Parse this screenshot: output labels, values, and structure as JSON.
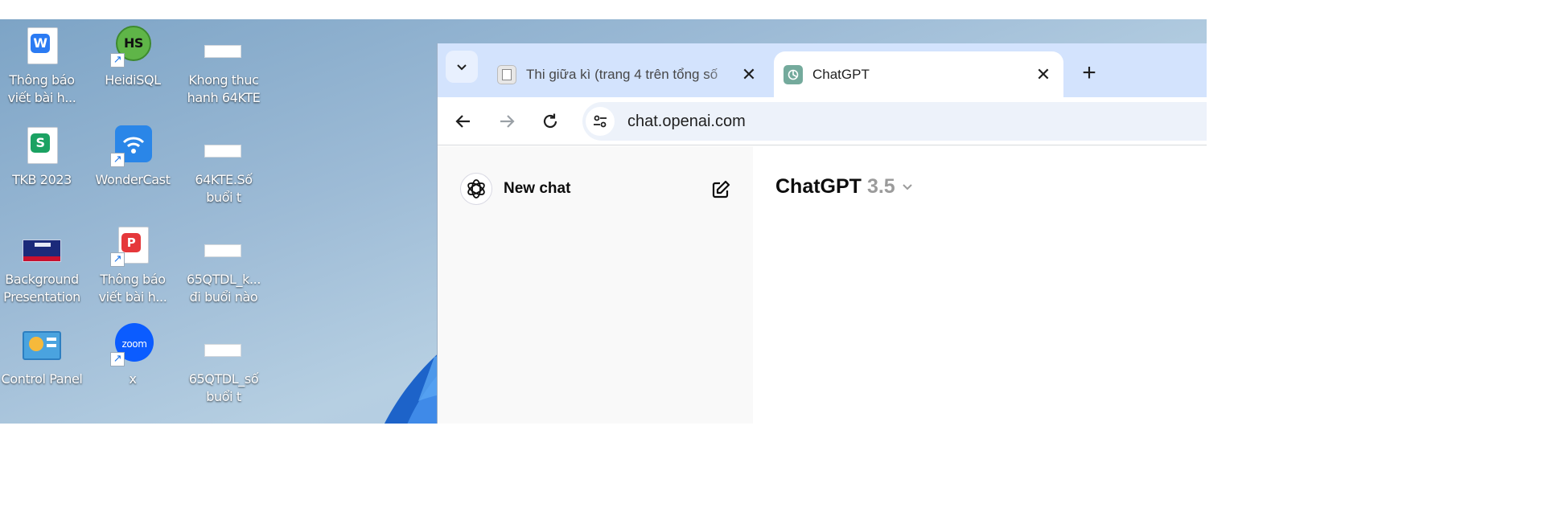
{
  "desktop": {
    "icons": [
      {
        "label_1": "Thông báo",
        "label_2": "viết bài h...",
        "icon": "wps-writer-doc-icon"
      },
      {
        "label_1": "HeidiSQL",
        "label_2": "",
        "icon": "heidisql-icon"
      },
      {
        "label_1": "Khong thuc",
        "label_2": "hanh 64KTE",
        "icon": "blank-file-icon"
      },
      {
        "label_1": "TKB 2023",
        "label_2": "",
        "icon": "wps-spreadsheet-icon"
      },
      {
        "label_1": "WonderCast",
        "label_2": "",
        "icon": "wondercast-icon"
      },
      {
        "label_1": "64KTE.Số",
        "label_2": "buổi t",
        "icon": "blank-file-icon"
      },
      {
        "label_1": "Background",
        "label_2": "Presentation",
        "icon": "presentation-image-icon"
      },
      {
        "label_1": "Thông báo",
        "label_2": "viết bài h...",
        "icon": "pdf-file-icon"
      },
      {
        "label_1": "65QTDL_k...",
        "label_2": "đi buổi nào",
        "icon": "blank-file-icon"
      },
      {
        "label_1": "Control Panel",
        "label_2": "",
        "icon": "control-panel-icon"
      },
      {
        "label_1": "x",
        "label_2": "",
        "icon": "zoom-icon"
      },
      {
        "label_1": "65QTDL_số",
        "label_2": "buổi t",
        "icon": "blank-file-icon"
      }
    ]
  },
  "browser": {
    "tabs": [
      {
        "title": "Thi giữa kì (trang 4 trên tổng số",
        "active": false,
        "close": "✕"
      },
      {
        "title": "ChatGPT",
        "active": true,
        "close": "✕"
      }
    ],
    "new_tab": "+",
    "url": "chat.openai.com"
  },
  "chatgpt": {
    "new_chat_label": "New chat",
    "model_name": "ChatGPT",
    "model_version": "3.5"
  },
  "colors": {
    "tabstrip": "#d3e3fd",
    "sidebar": "#f9f9f9",
    "omnibox": "#edf2fa",
    "chatgpt_green": "#74aa9c"
  }
}
